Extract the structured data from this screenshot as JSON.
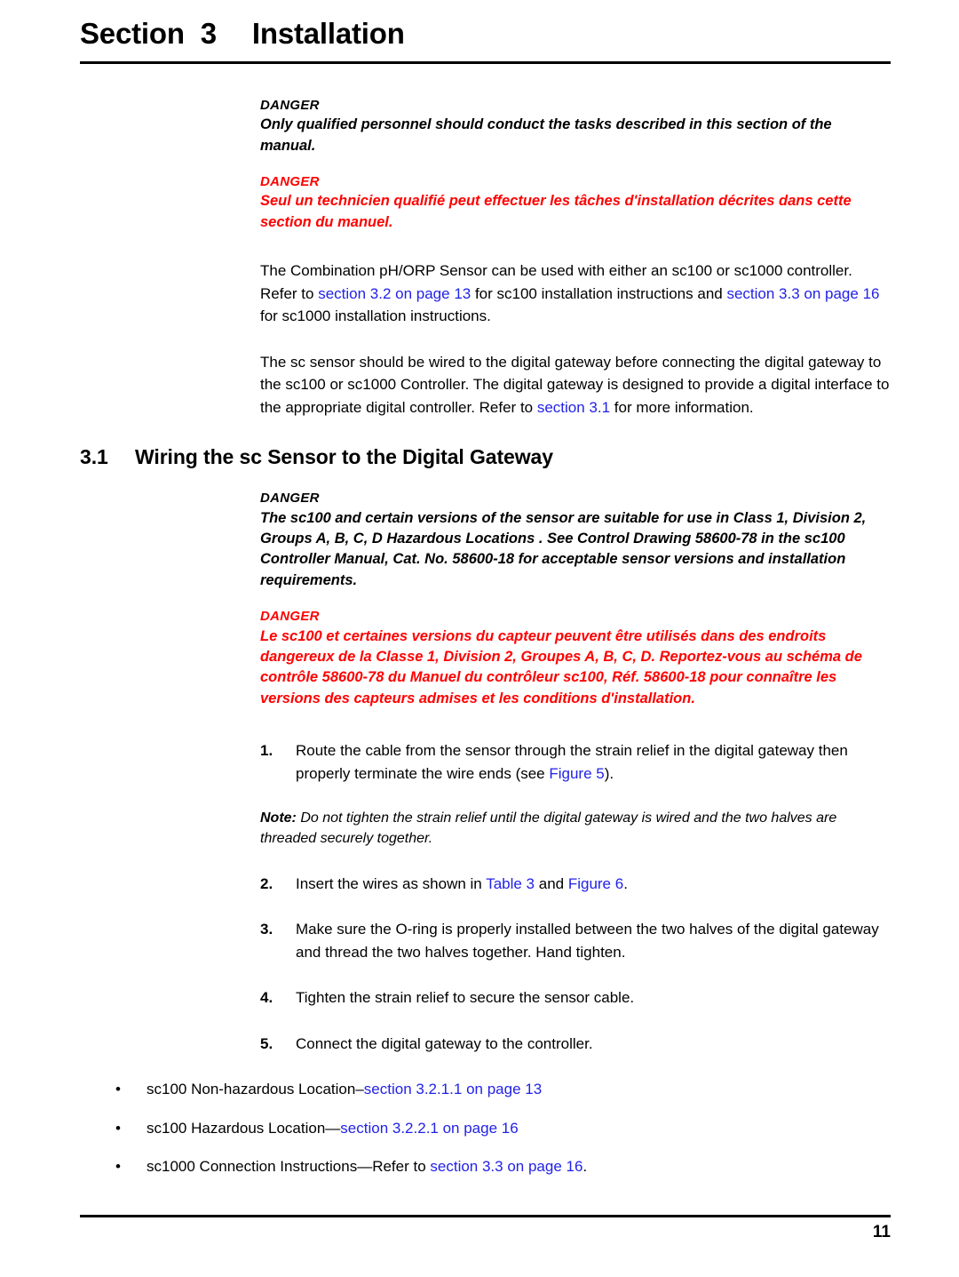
{
  "header": {
    "section_label": "Section  3",
    "section_name": "Installation"
  },
  "danger_1": {
    "label_en": "DANGER",
    "body_en": "Only qualified personnel should conduct the tasks described in this section of the manual.",
    "label_fr": "DANGER",
    "body_fr": "Seul un technicien qualifié peut effectuer les tâches d'installation décrites dans cette section du manuel."
  },
  "paragraphs": {
    "p1_a": "The Combination pH/ORP Sensor can be used with either an sc100 or sc1000 controller. Refer to ",
    "p1_link1": "section 3.2 on page 13",
    "p1_b": " for sc100 installation instructions and ",
    "p1_link2": "section 3.3 on page 16",
    "p1_c": " for sc1000 installation instructions.",
    "p2_a": "The sc sensor should be wired to the digital gateway before connecting the digital gateway to the sc100 or sc1000 Controller. The digital gateway is designed to provide a digital interface to the appropriate digital controller. Refer to ",
    "p2_link1": "section 3.1",
    "p2_b": " for more information."
  },
  "section_31": {
    "number": "3.1",
    "title": "Wiring the sc Sensor to the Digital Gateway"
  },
  "danger_2": {
    "label_en": "DANGER",
    "body_en": "The sc100 and certain versions of the sensor are suitable for use in Class 1, Division 2, Groups A, B, C, D Hazardous Locations . See Control Drawing 58600-78 in the sc100 Controller Manual, Cat. No. 58600-18 for acceptable sensor versions and installation requirements.",
    "label_fr": "DANGER",
    "body_fr": "Le sc100 et certaines versions du capteur peuvent être utilisés dans des endroits dangereux de la Classe 1, Division 2, Groupes A, B, C, D. Reportez-vous au schéma de contrôle 58600-78 du Manuel du contrôleur sc100, Réf. 58600-18 pour connaître les versions des capteurs admises et les conditions d'installation."
  },
  "steps": {
    "s1_num": "1.",
    "s1_a": "Route the cable from the sensor through the strain relief in the digital gateway then properly terminate the wire ends (see ",
    "s1_link": "Figure 5",
    "s1_b": ").",
    "s2_num": "2.",
    "s2_a": "Insert the wires as shown in ",
    "s2_link1": "Table 3",
    "s2_b": " and ",
    "s2_link2": "Figure 6",
    "s2_c": ".",
    "s3_num": "3.",
    "s3_text": "Make sure the O-ring is properly installed between the two halves of the digital gateway and thread the two halves together. Hand tighten.",
    "s4_num": "4.",
    "s4_text": "Tighten the strain relief to secure the sensor cable.",
    "s5_num": "5.",
    "s5_text": "Connect the digital gateway to the controller."
  },
  "note": {
    "label": "Note:",
    "text": " Do not tighten the strain relief until the digital gateway is wired and the two halves are threaded securely together."
  },
  "bullets": {
    "dot": "•",
    "b1_a": "sc100 Non-hazardous Location–",
    "b1_link": "section 3.2.1.1 on page 13",
    "b2_a": "sc100 Hazardous Location—",
    "b2_link": "section 3.2.2.1 on page 16",
    "b3_a": "sc1000 Connection Instructions—Refer to ",
    "b3_link": "section 3.3 on page 16",
    "b3_b": "."
  },
  "footer": {
    "page_number": "11"
  },
  "colors": {
    "link": "#2222E8",
    "danger_fr": "#FF0000",
    "text": "#000000"
  }
}
